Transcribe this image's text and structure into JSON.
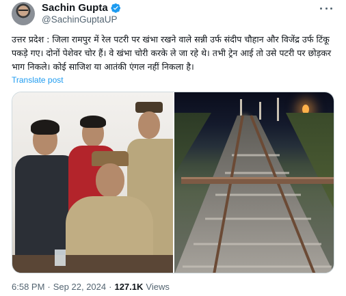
{
  "author": {
    "name": "Sachin Gupta",
    "handle": "@SachinGuptaUP",
    "verified": true
  },
  "post": {
    "text": "उत्तर प्रदेश : जिला रामपुर में रेल पटरी पर खंभा रखने वाले सन्नी उर्फ संदीप चौहान और विजेंद्र उर्फ टिंकू पकड़े गए। दोनों पेशेवर चोर हैं। वे खंभा चोरी करके ले जा रहे थे। तभी ट्रेन आई तो उसे पटरी पर छोड़कर भाग निकले। कोई साजिश या आतंकी एंगल नहीं निकला है।",
    "translate_label": "Translate post"
  },
  "meta": {
    "time": "6:58 PM",
    "separator": "·",
    "date": "Sep 22, 2024",
    "views_count": "127.1K",
    "views_label": "Views"
  },
  "icons": {
    "more": "more-options-icon",
    "verified": "verified-badge-icon"
  },
  "colors": {
    "accent": "#1d9bf0",
    "secondary_text": "#536471",
    "primary_text": "#0f1419"
  }
}
